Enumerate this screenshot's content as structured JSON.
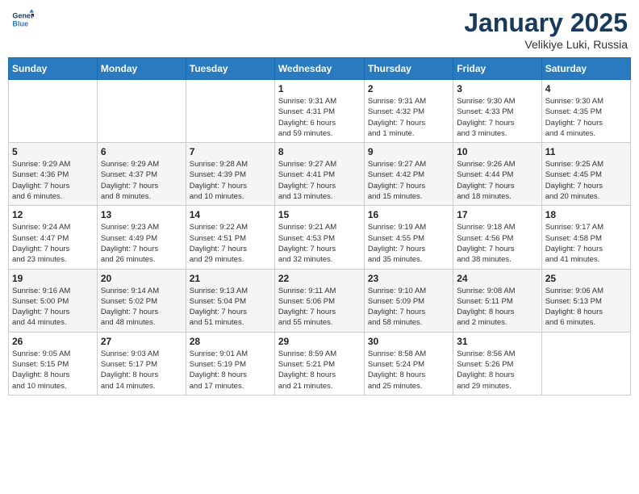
{
  "logo": {
    "line1": "General",
    "line2": "Blue"
  },
  "header": {
    "month": "January 2025",
    "location": "Velikiye Luki, Russia"
  },
  "days_of_week": [
    "Sunday",
    "Monday",
    "Tuesday",
    "Wednesday",
    "Thursday",
    "Friday",
    "Saturday"
  ],
  "weeks": [
    [
      {
        "day": "",
        "info": ""
      },
      {
        "day": "",
        "info": ""
      },
      {
        "day": "",
        "info": ""
      },
      {
        "day": "1",
        "info": "Sunrise: 9:31 AM\nSunset: 4:31 PM\nDaylight: 6 hours\nand 59 minutes."
      },
      {
        "day": "2",
        "info": "Sunrise: 9:31 AM\nSunset: 4:32 PM\nDaylight: 7 hours\nand 1 minute."
      },
      {
        "day": "3",
        "info": "Sunrise: 9:30 AM\nSunset: 4:33 PM\nDaylight: 7 hours\nand 3 minutes."
      },
      {
        "day": "4",
        "info": "Sunrise: 9:30 AM\nSunset: 4:35 PM\nDaylight: 7 hours\nand 4 minutes."
      }
    ],
    [
      {
        "day": "5",
        "info": "Sunrise: 9:29 AM\nSunset: 4:36 PM\nDaylight: 7 hours\nand 6 minutes."
      },
      {
        "day": "6",
        "info": "Sunrise: 9:29 AM\nSunset: 4:37 PM\nDaylight: 7 hours\nand 8 minutes."
      },
      {
        "day": "7",
        "info": "Sunrise: 9:28 AM\nSunset: 4:39 PM\nDaylight: 7 hours\nand 10 minutes."
      },
      {
        "day": "8",
        "info": "Sunrise: 9:27 AM\nSunset: 4:41 PM\nDaylight: 7 hours\nand 13 minutes."
      },
      {
        "day": "9",
        "info": "Sunrise: 9:27 AM\nSunset: 4:42 PM\nDaylight: 7 hours\nand 15 minutes."
      },
      {
        "day": "10",
        "info": "Sunrise: 9:26 AM\nSunset: 4:44 PM\nDaylight: 7 hours\nand 18 minutes."
      },
      {
        "day": "11",
        "info": "Sunrise: 9:25 AM\nSunset: 4:45 PM\nDaylight: 7 hours\nand 20 minutes."
      }
    ],
    [
      {
        "day": "12",
        "info": "Sunrise: 9:24 AM\nSunset: 4:47 PM\nDaylight: 7 hours\nand 23 minutes."
      },
      {
        "day": "13",
        "info": "Sunrise: 9:23 AM\nSunset: 4:49 PM\nDaylight: 7 hours\nand 26 minutes."
      },
      {
        "day": "14",
        "info": "Sunrise: 9:22 AM\nSunset: 4:51 PM\nDaylight: 7 hours\nand 29 minutes."
      },
      {
        "day": "15",
        "info": "Sunrise: 9:21 AM\nSunset: 4:53 PM\nDaylight: 7 hours\nand 32 minutes."
      },
      {
        "day": "16",
        "info": "Sunrise: 9:19 AM\nSunset: 4:55 PM\nDaylight: 7 hours\nand 35 minutes."
      },
      {
        "day": "17",
        "info": "Sunrise: 9:18 AM\nSunset: 4:56 PM\nDaylight: 7 hours\nand 38 minutes."
      },
      {
        "day": "18",
        "info": "Sunrise: 9:17 AM\nSunset: 4:58 PM\nDaylight: 7 hours\nand 41 minutes."
      }
    ],
    [
      {
        "day": "19",
        "info": "Sunrise: 9:16 AM\nSunset: 5:00 PM\nDaylight: 7 hours\nand 44 minutes."
      },
      {
        "day": "20",
        "info": "Sunrise: 9:14 AM\nSunset: 5:02 PM\nDaylight: 7 hours\nand 48 minutes."
      },
      {
        "day": "21",
        "info": "Sunrise: 9:13 AM\nSunset: 5:04 PM\nDaylight: 7 hours\nand 51 minutes."
      },
      {
        "day": "22",
        "info": "Sunrise: 9:11 AM\nSunset: 5:06 PM\nDaylight: 7 hours\nand 55 minutes."
      },
      {
        "day": "23",
        "info": "Sunrise: 9:10 AM\nSunset: 5:09 PM\nDaylight: 7 hours\nand 58 minutes."
      },
      {
        "day": "24",
        "info": "Sunrise: 9:08 AM\nSunset: 5:11 PM\nDaylight: 8 hours\nand 2 minutes."
      },
      {
        "day": "25",
        "info": "Sunrise: 9:06 AM\nSunset: 5:13 PM\nDaylight: 8 hours\nand 6 minutes."
      }
    ],
    [
      {
        "day": "26",
        "info": "Sunrise: 9:05 AM\nSunset: 5:15 PM\nDaylight: 8 hours\nand 10 minutes."
      },
      {
        "day": "27",
        "info": "Sunrise: 9:03 AM\nSunset: 5:17 PM\nDaylight: 8 hours\nand 14 minutes."
      },
      {
        "day": "28",
        "info": "Sunrise: 9:01 AM\nSunset: 5:19 PM\nDaylight: 8 hours\nand 17 minutes."
      },
      {
        "day": "29",
        "info": "Sunrise: 8:59 AM\nSunset: 5:21 PM\nDaylight: 8 hours\nand 21 minutes."
      },
      {
        "day": "30",
        "info": "Sunrise: 8:58 AM\nSunset: 5:24 PM\nDaylight: 8 hours\nand 25 minutes."
      },
      {
        "day": "31",
        "info": "Sunrise: 8:56 AM\nSunset: 5:26 PM\nDaylight: 8 hours\nand 29 minutes."
      },
      {
        "day": "",
        "info": ""
      }
    ]
  ]
}
